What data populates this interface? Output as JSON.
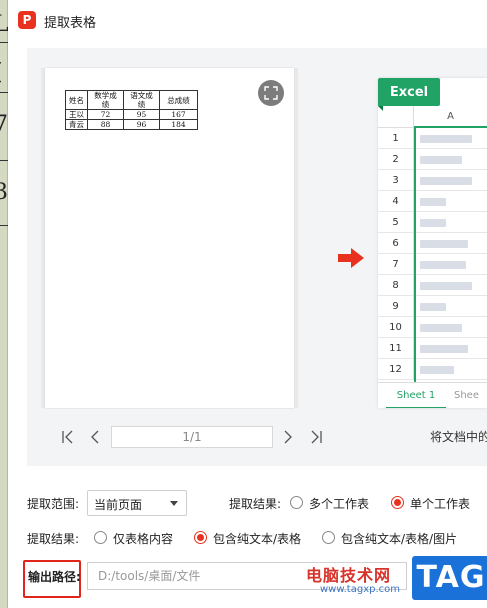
{
  "window": {
    "title": "提取表格",
    "logo_letter": "P"
  },
  "background_marks": [
    "L",
    "(",
    "7",
    "3"
  ],
  "preview": {
    "doc_table": {
      "rows": [
        [
          "姓名",
          "数学成绩",
          "语文成绩",
          "总成绩"
        ],
        [
          "王以",
          "72",
          "95",
          "167"
        ],
        [
          "青云",
          "88",
          "96",
          "184"
        ]
      ]
    },
    "excel": {
      "badge": "Excel",
      "column_header": "A",
      "row_numbers": [
        "1",
        "2",
        "3",
        "4",
        "5",
        "6",
        "7",
        "8",
        "9",
        "10",
        "11",
        "12"
      ],
      "sheet_tab_active": "Sheet 1",
      "sheet_tab_next": "Shee"
    },
    "pager": {
      "page_indicator": "1/1"
    },
    "hint_text": "将文档中的"
  },
  "options": {
    "range_label": "提取范围:",
    "range_value": "当前页面",
    "result_label": "提取结果:",
    "result_multi": "多个工作表",
    "result_single": "单个工作表",
    "content_label": "提取结果:",
    "content_table_only": "仅表格内容",
    "content_with_text": "包含纯文本/表格",
    "content_with_images": "包含纯文本/表格/图片",
    "output_label": "输出路径:",
    "output_path": "D:/tools/桌面/文件"
  },
  "watermark": {
    "site_name": "电脑技术网",
    "url": "www.tagxp.com",
    "tag": "TAG"
  },
  "colors": {
    "accent": "#e8321f",
    "excel_green": "#21a366",
    "tag_blue": "#1a72d9"
  }
}
